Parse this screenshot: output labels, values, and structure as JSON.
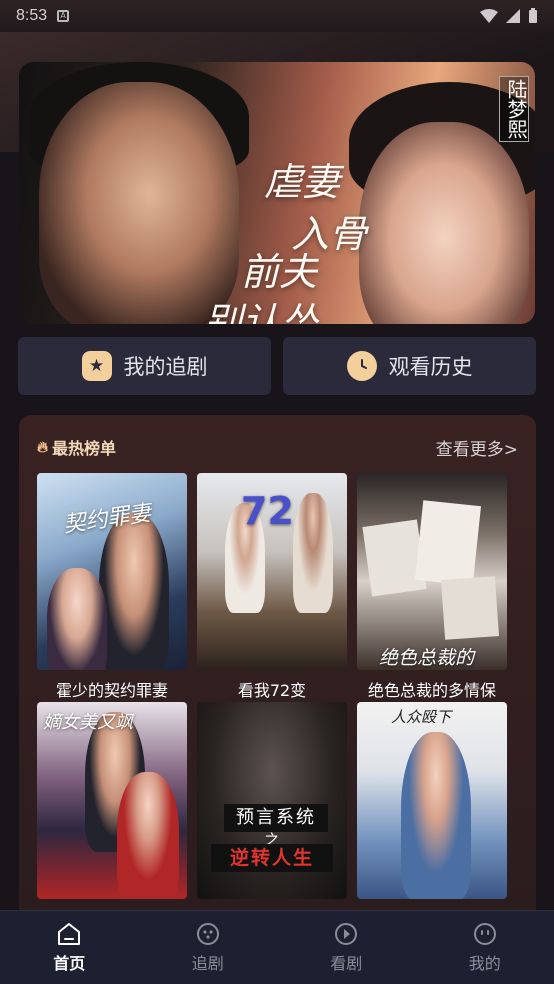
{
  "status_bar": {
    "time": "8:53",
    "a_icon": "A"
  },
  "banner": {
    "title_lines": [
      "虐妻",
      "入骨",
      "前夫",
      "别认怂"
    ],
    "side_name": "陆梦熙"
  },
  "quick_actions": {
    "favorites_label": "我的追剧",
    "history_label": "观看历史"
  },
  "hot_list": {
    "title": "最热榜单",
    "more_label": "查看更多>",
    "items": [
      {
        "title": "霍少的契约罪妻",
        "poster_text": "契约罪妻"
      },
      {
        "title": "看我72变",
        "poster_text": "72"
      },
      {
        "title": "绝色总裁的多情保",
        "poster_text": "绝色总裁的"
      },
      {
        "title": "",
        "poster_text": "嫡女美又飒"
      },
      {
        "title": "",
        "poster_text_1": "预言系统",
        "poster_text_mid": "之",
        "poster_text_2": "逆转人生"
      },
      {
        "title": "",
        "poster_text": "人众殴下"
      }
    ]
  },
  "tabbar": {
    "tabs": [
      {
        "label": "首页",
        "active": true
      },
      {
        "label": "追剧",
        "active": false
      },
      {
        "label": "看剧",
        "active": false
      },
      {
        "label": "我的",
        "active": false
      }
    ]
  },
  "colors": {
    "accent": "#f3cf9c",
    "tab_bg": "#1d2030",
    "section_bg": "#3a2222"
  }
}
